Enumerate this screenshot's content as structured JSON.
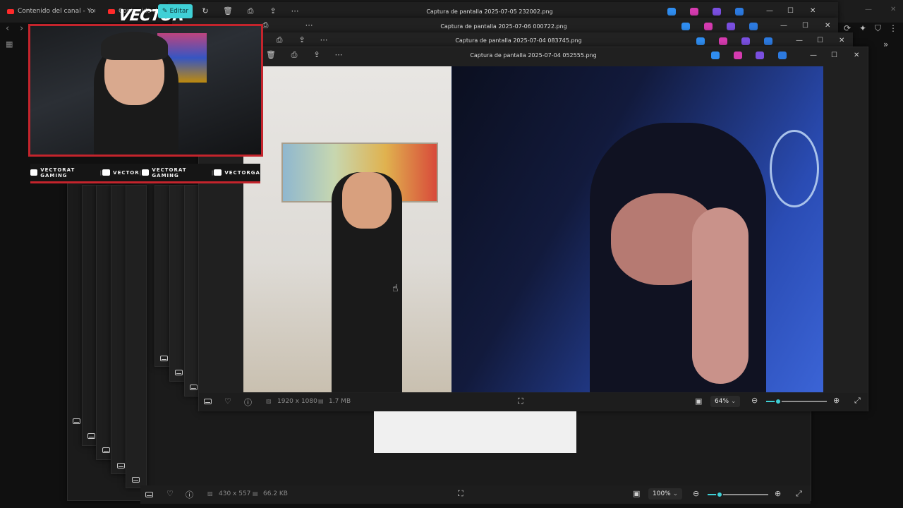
{
  "browser": {
    "tabs": [
      {
        "label": "Contenido del canal - YouTube"
      },
      {
        "label": "Contenido del"
      }
    ]
  },
  "overlay": {
    "brand": "VECTOR",
    "edit_label": "Editar",
    "social": [
      {
        "icon": "youtube-icon",
        "label": "VECTORAT GAMING"
      },
      {
        "icon": "twitch-icon",
        "label": "VECTOR"
      },
      {
        "icon": "twitter-icon",
        "label": "VECTORAT GAMING"
      },
      {
        "icon": "instagram-icon",
        "label": "VECTORGA"
      }
    ],
    "accent": "#c4242c"
  },
  "windows": [
    {
      "title": "Captura de pantalla 2025-07-05 232002.png"
    },
    {
      "title": "Captura de pantalla 2025-07-06 000722.png"
    },
    {
      "title": "Captura de pantalla 2025-07-04 083745.png"
    },
    {
      "title": "Captura de pantalla 2025-07-04 052555.png"
    }
  ],
  "main_viewer": {
    "dimensions": "1920 x 1080",
    "size": "1.7 MB",
    "zoom": "64%",
    "zoom_level": 0.2
  },
  "back_viewer": {
    "dimensions": "430 x 557",
    "size": "66.2 KB",
    "zoom": "100%",
    "zoom_level": 0.2
  },
  "colors": {
    "accent": "#3fd0d6",
    "background": "#1f1f1f"
  }
}
